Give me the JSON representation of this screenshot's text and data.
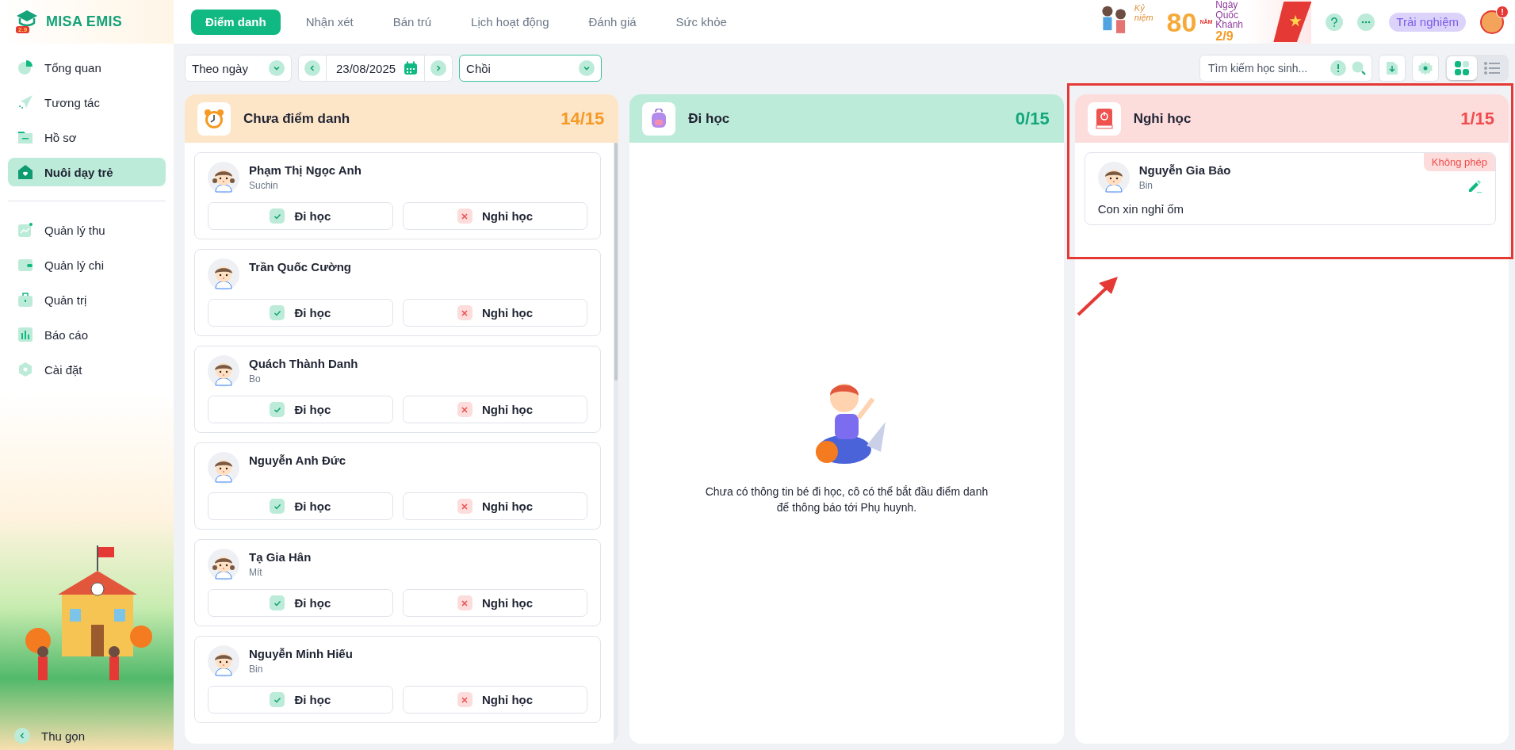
{
  "logo": {
    "text": "MISA EMIS",
    "badge": "2.9"
  },
  "sidebar": {
    "groups": [
      {
        "items": [
          {
            "label": "Tổng quan",
            "kind": "pie",
            "selected": false
          },
          {
            "label": "Tương tác",
            "kind": "send",
            "selected": false
          },
          {
            "label": "Hồ sơ",
            "kind": "folder",
            "selected": false
          },
          {
            "label": "Nuôi dạy trẻ",
            "kind": "home",
            "selected": true
          }
        ]
      },
      {
        "items": [
          {
            "label": "Quản lý thu",
            "kind": "chart",
            "selected": false
          },
          {
            "label": "Quản lý chi",
            "kind": "wallet",
            "selected": false
          },
          {
            "label": "Quản trị",
            "kind": "briefcase",
            "selected": false
          },
          {
            "label": "Báo cáo",
            "kind": "bars",
            "selected": false
          },
          {
            "label": "Cài đặt",
            "kind": "settings",
            "selected": false
          }
        ]
      }
    ],
    "collapse": {
      "label": "Thu gọn"
    }
  },
  "tabs": [
    {
      "label": "Điểm danh",
      "selected": true
    },
    {
      "label": "Nhận xét",
      "selected": false
    },
    {
      "label": "Bán trú",
      "selected": false
    },
    {
      "label": "Lịch hoạt động",
      "selected": false
    },
    {
      "label": "Đánh giá",
      "selected": false
    },
    {
      "label": "Sức khỏe",
      "selected": false
    }
  ],
  "banner": {
    "caption": "Kỷ niệm",
    "number": "80",
    "unit": "NĂM",
    "line1": "Ngày",
    "line2": "Quốc Khánh",
    "date": "2/9"
  },
  "header_actions": {
    "trial_button": "Trải nghiệm",
    "notification_badge": "!"
  },
  "toolbar": {
    "mode_select": "Theo ngày",
    "date": "23/08/2025",
    "class_select": "Chồi",
    "search": {
      "placeholder": "Tìm kiếm học sinh..."
    },
    "views": [
      {
        "kind": "grid",
        "selected": true
      },
      {
        "kind": "list",
        "selected": false
      }
    ]
  },
  "columns": [
    {
      "kind": "pending",
      "title": "Chưa điểm danh",
      "count": "14/15",
      "highlighted": false,
      "students": [
        {
          "name": "Phạm Thị Ngọc Anh",
          "nickname": "Suchin",
          "kind": "girl",
          "actions": [
            "Đi học",
            "Nghỉ học"
          ]
        },
        {
          "name": "Trần Quốc Cường",
          "kind": "boy",
          "actions": [
            "Đi học",
            "Nghỉ học"
          ]
        },
        {
          "name": "Quách Thành Danh",
          "nickname": "Bo",
          "kind": "boy",
          "actions": [
            "Đi học",
            "Nghỉ học"
          ]
        },
        {
          "name": "Nguyễn Anh Đức",
          "kind": "boy",
          "actions": [
            "Đi học",
            "Nghỉ học"
          ]
        },
        {
          "name": "Tạ Gia Hân",
          "nickname": "Mít",
          "kind": "girl",
          "actions": [
            "Đi học",
            "Nghỉ học"
          ]
        },
        {
          "name": "Nguyễn Minh Hiếu",
          "nickname": "Bin",
          "kind": "boy",
          "actions": [
            "Đi học",
            "Nghỉ học"
          ]
        }
      ]
    },
    {
      "kind": "present",
      "title": "Đi học",
      "count": "0/15",
      "highlighted": false,
      "empty_message": "Chưa có thông tin bé đi học, cô có thể bắt đầu điểm danh để thông báo tới Phụ huynh."
    },
    {
      "kind": "absent",
      "title": "Nghỉ học",
      "count": "1/15",
      "highlighted": true,
      "students": [
        {
          "name": "Nguyễn Gia Bảo",
          "nickname": "Bin",
          "kind": "boy",
          "status": "Không phép",
          "note": "Con xin nghỉ ốm"
        }
      ]
    }
  ]
}
